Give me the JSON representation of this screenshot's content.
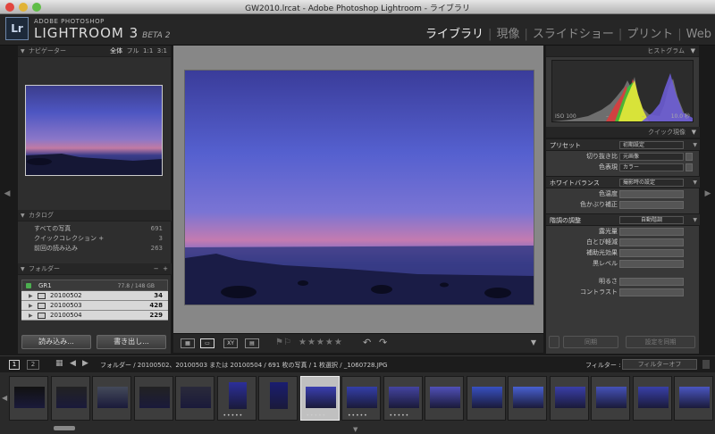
{
  "window": {
    "title": "GW2010.lrcat - Adobe Photoshop Lightroom - ライブラリ"
  },
  "identity": {
    "product_top": "ADOBE PHOTOSHOP",
    "product_main": "LIGHTROOM 3",
    "beta": "BETA 2",
    "logo": "Lr"
  },
  "modules": [
    "ライブラリ",
    "現像",
    "スライドショー",
    "プリント",
    "Web"
  ],
  "navigator": {
    "title": "ナビゲーター",
    "zoom": [
      "全体",
      "フル",
      "1:1",
      "3:1"
    ]
  },
  "catalog": {
    "title": "カタログ",
    "items": [
      {
        "label": "すべての写真",
        "count": "691"
      },
      {
        "label": "クイックコレクション +",
        "count": "3"
      },
      {
        "label": "前回の読み込み",
        "count": "263"
      }
    ]
  },
  "folders": {
    "title": "フォルダー",
    "controls": [
      "−",
      "+"
    ],
    "drive": {
      "label": "GR1",
      "space": "77.8 / 148 GB"
    },
    "items": [
      {
        "label": "20100502",
        "count": "34"
      },
      {
        "label": "20100503",
        "count": "428"
      },
      {
        "label": "20100504",
        "count": "229"
      }
    ]
  },
  "left_buttons": {
    "import": "読み込み...",
    "export": "書き出し..."
  },
  "histogram": {
    "title": "ヒストグラム",
    "iso": "ISO 100",
    "dash1": "–",
    "dash2": "–",
    "exposure": "10.0 秒"
  },
  "quick_develop": {
    "title": "クイック現像",
    "preset_label": "プリセット",
    "preset_value": "初期設定",
    "crop_label": "切り抜き比",
    "crop_value": "元画像",
    "color_label": "色表現",
    "color_value": "カラー",
    "wb_label": "ホワイトバランス",
    "wb_value": "撮影時の設定",
    "temp_label": "色温度",
    "tint_label": "色かぶり補正",
    "tone_label": "階調の調整",
    "tone_button": "自動階調",
    "exposure_label": "露光量",
    "recovery_label": "白とび軽減",
    "fill_label": "補助光効果",
    "blacks_label": "黒レベル",
    "brightness_label": "明るさ",
    "contrast_label": "コントラスト"
  },
  "right_buttons": {
    "sync": "同期",
    "reset": "設定を同期"
  },
  "secondary": {
    "pages": [
      "1",
      "2"
    ],
    "path": "フォルダー / 20100502、20100503 または 20100504 / 691 枚の写真 / 1 枚選択 / _1060728.JPG",
    "filter_label": "フィルター :",
    "filter_value": "フィルターオフ"
  },
  "toolbar": {
    "stars": "★★★★★"
  },
  "filmstrip": [
    {
      "dots": ""
    },
    {
      "dots": ""
    },
    {
      "dots": ""
    },
    {
      "dots": ""
    },
    {
      "dots": ""
    },
    {
      "dots": "•••••"
    },
    {
      "dots": ""
    },
    {
      "dots": "•••••"
    },
    {
      "dots": "•••••"
    },
    {
      "dots": "•••••"
    },
    {
      "dots": ""
    },
    {
      "dots": ""
    },
    {
      "dots": ""
    },
    {
      "dots": ""
    },
    {
      "dots": ""
    },
    {
      "dots": ""
    },
    {
      "dots": ""
    }
  ]
}
